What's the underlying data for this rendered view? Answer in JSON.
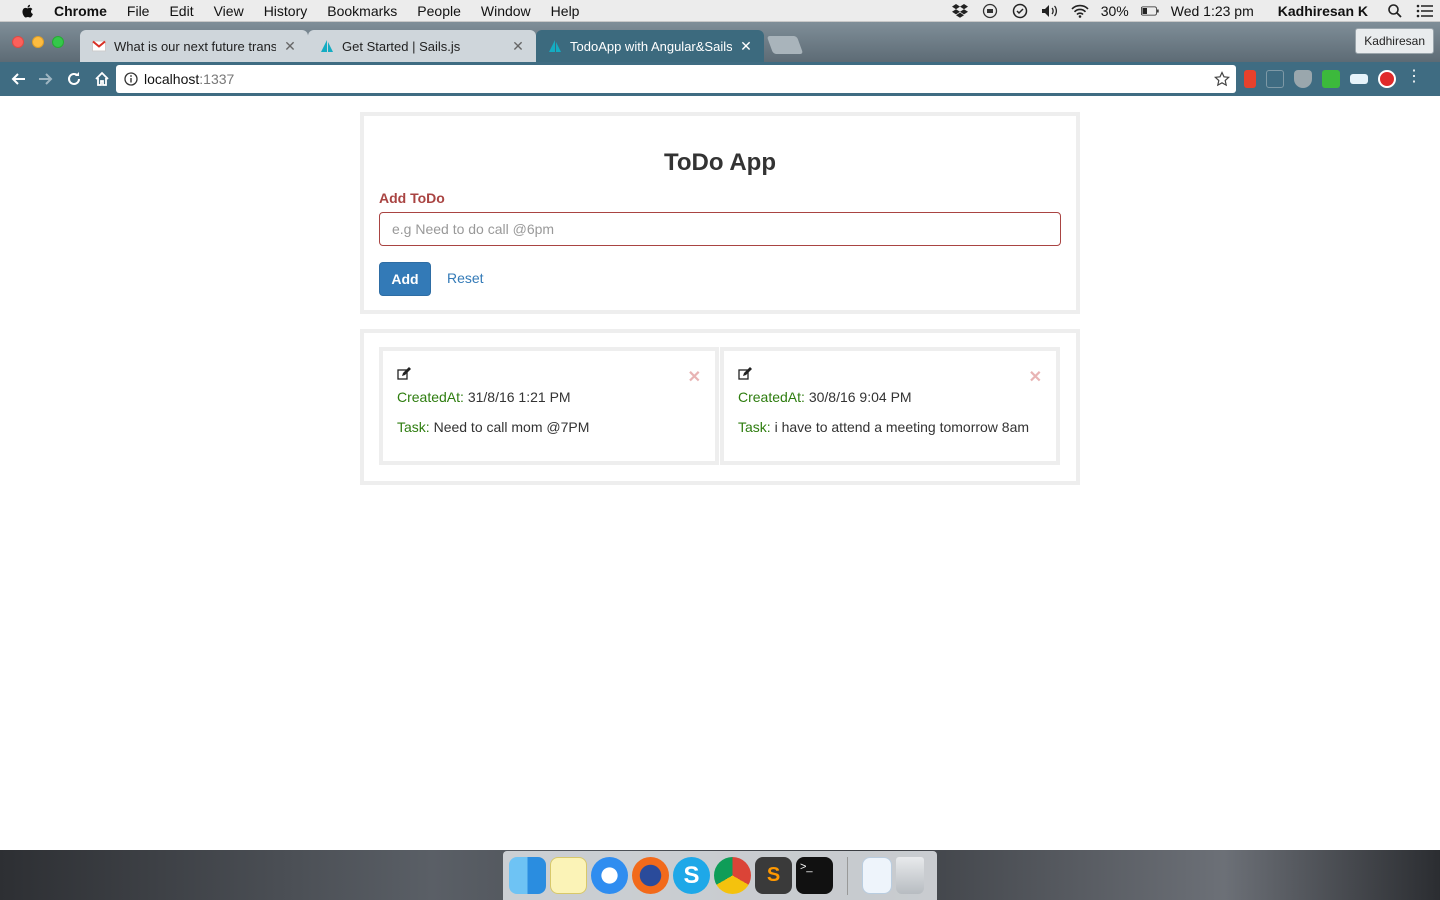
{
  "menubar": {
    "app": "Chrome",
    "items": [
      "File",
      "Edit",
      "View",
      "History",
      "Bookmarks",
      "People",
      "Window",
      "Help"
    ],
    "battery": "30%",
    "clock": "Wed 1:23 pm",
    "user": "Kadhiresan K"
  },
  "browser": {
    "tabs": [
      {
        "title": "What is our next future transa",
        "favicon": "gmail-icon"
      },
      {
        "title": "Get Started | Sails.js",
        "favicon": "sails-icon"
      },
      {
        "title": "TodoApp with Angular&Sails J",
        "favicon": "sails-icon"
      }
    ],
    "profile": "Kadhiresan",
    "url_host": "localhost",
    "url_port": ":1337"
  },
  "app": {
    "title": "ToDo App",
    "field_label": "Add ToDo",
    "input_placeholder": "e.g Need to do call @6pm",
    "input_value": "",
    "add_label": "Add",
    "reset_label": "Reset",
    "todos": [
      {
        "created_label": "CreatedAt:",
        "created_at": "31/8/16 1:21 PM",
        "task_label": "Task:",
        "task": "Need to call mom @7PM"
      },
      {
        "created_label": "CreatedAt:",
        "created_at": "30/8/16 9:04 PM",
        "task_label": "Task:",
        "task": "i have to attend a meeting tomorrow 8am"
      }
    ]
  },
  "dock": {
    "apps": [
      "finder-icon",
      "notes-icon",
      "safari-icon",
      "firefox-icon",
      "skype-icon",
      "chrome-icon",
      "sublime-text-icon",
      "terminal-icon",
      "documents-icon",
      "trash-icon"
    ]
  },
  "colors": {
    "primary": "#337ab7",
    "error": "#a94442",
    "label_green": "#2e7d0f",
    "delete_pink": "#e8b4b4",
    "toolbar": "#3f6c82"
  }
}
